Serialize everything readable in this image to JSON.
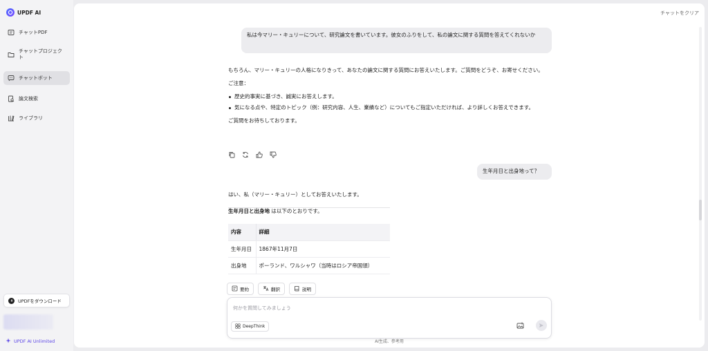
{
  "app": {
    "brand": "UPDF AI"
  },
  "sidebar": {
    "items": [
      {
        "label": "チャットPDF",
        "icon": "chat-pdf-icon"
      },
      {
        "label": "チャットプロジェクト",
        "icon": "folder-icon"
      },
      {
        "label": "チャットボット",
        "icon": "chatbot-icon",
        "active": true
      },
      {
        "label": "論文検索",
        "icon": "paper-search-icon"
      },
      {
        "label": "ライブラリ",
        "icon": "library-icon"
      }
    ],
    "download_label": "UPDFをダウンロード",
    "plan_label": "UPDF AI Unlimited"
  },
  "header": {
    "clear_label": "チャットをクリア"
  },
  "chat": {
    "user_msg_1": "私は今マリー・キュリーについて、研究論文を書いています。彼女のふりをして、私の論文に関する質問を答えてくれないか",
    "ai_msg_1": {
      "intro": "もちろん、マリー・キュリーの人格になりきって、あなたの論文に関する質問にお答えいたします。ご質問をどうぞ、お寄せください。",
      "notes_heading": "ご注意：",
      "bullets": [
        "歴史的事実に基づき、誠実にお答えします。",
        "気になる点や、特定のトピック（例：研究内容、人生、業績など）についてもご指定いただければ、より詳しくお答えできます。"
      ],
      "closing": "ご質問をお待ちしております。"
    },
    "user_msg_2": "生年月日と出身地って？",
    "ai_msg_2": {
      "intro": "はい、私（マリー・キュリー）としてお答えいたします。",
      "lead_bold": "生年月日と出身地",
      "lead_rest": " は以下のとおりです。",
      "table": {
        "headers": [
          "内容",
          "詳細"
        ],
        "rows": [
          [
            "生年月日",
            "1867年11月7日"
          ],
          [
            "出身地",
            "ポーランド、ワルシャワ（当時はロシア帝国領）"
          ]
        ]
      }
    }
  },
  "quick_actions": [
    "要約",
    "翻訳",
    "説明"
  ],
  "composer": {
    "placeholder": "何かを質問してみましょう",
    "deepthink_label": "DeepThink"
  },
  "footer_note": "AI生成、参考用",
  "colors": {
    "accent": "#5b45e6",
    "bubble": "#ececef"
  }
}
